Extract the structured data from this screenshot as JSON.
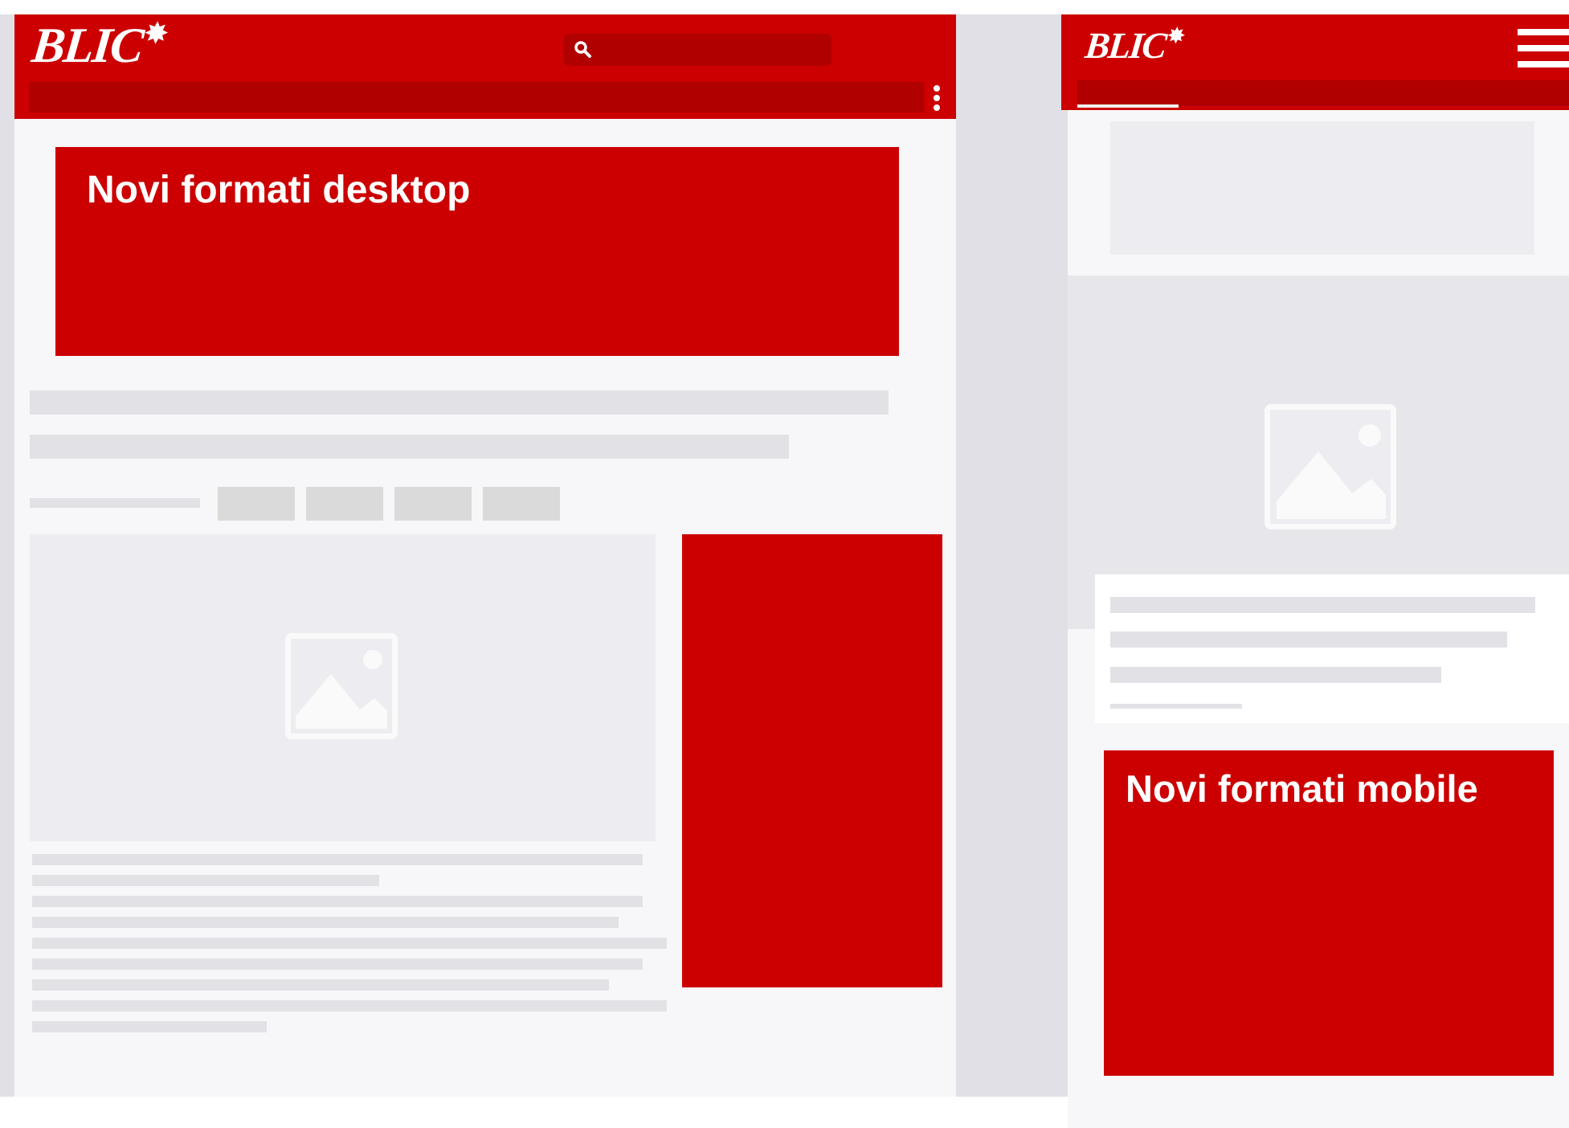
{
  "desktop": {
    "logo": "BLIC",
    "search": {
      "icon": "search-icon",
      "placeholder": ""
    },
    "menu_icon": "kebab-menu-icon",
    "banner_title": "Novi formati desktop",
    "image_icon": "image-placeholder-icon"
  },
  "mobile": {
    "logo": "BLIC",
    "menu_icon": "hamburger-menu-icon",
    "banner_title": "Novi formati mobile",
    "image_icon": "image-placeholder-icon"
  },
  "colors": {
    "brand_red": "#cc0000",
    "dark_red": "#b00000",
    "page_bg": "#f7f7f9",
    "outer_bg": "#e0e0e6",
    "placeholder_bar": "#e2e2e6"
  }
}
